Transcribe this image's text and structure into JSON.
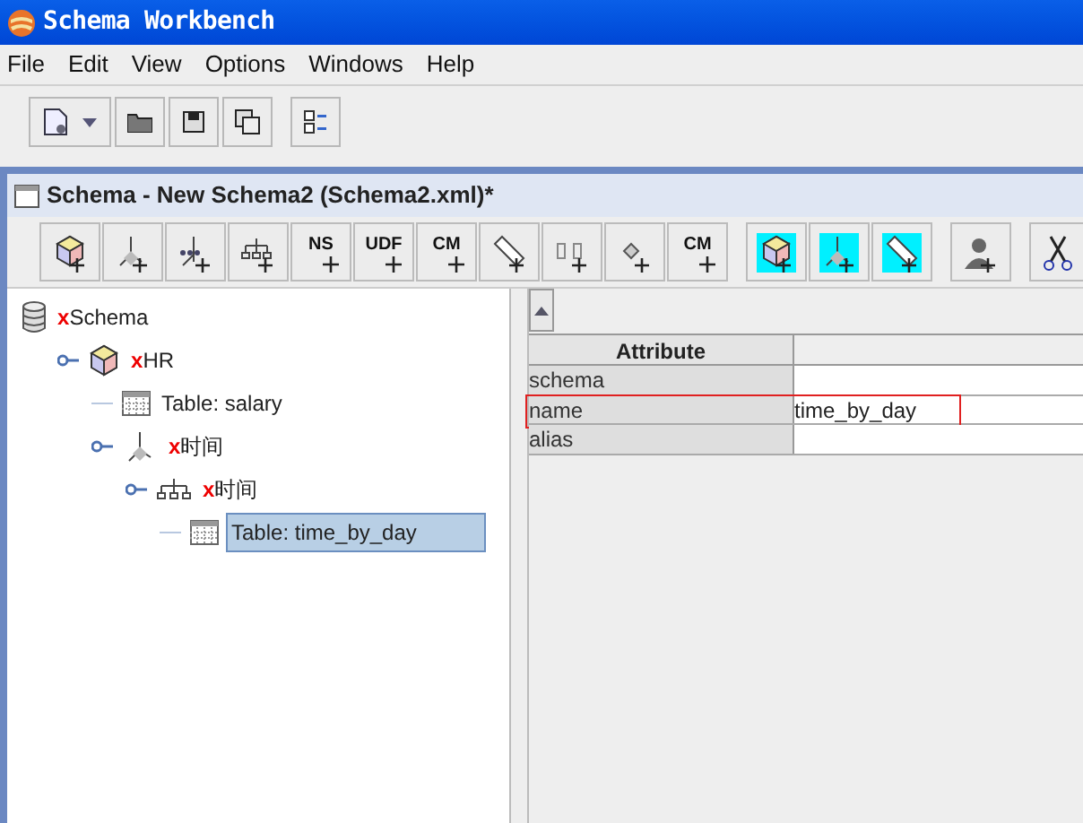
{
  "window": {
    "title": "Schema Workbench"
  },
  "menu": [
    "File",
    "Edit",
    "View",
    "Options",
    "Windows",
    "Help"
  ],
  "inner_window": {
    "title": "Schema - New Schema2 (Schema2.xml)*"
  },
  "schema_toolbar": {
    "labels": [
      "NS",
      "UDF",
      "CM",
      "CM"
    ]
  },
  "tree": [
    {
      "label": "Schema",
      "mark": "x",
      "kind": "schema",
      "selected": false,
      "children": [
        {
          "label": "HR",
          "mark": "x",
          "kind": "cube",
          "selected": false,
          "expanded": true,
          "children": [
            {
              "label": "Table: salary",
              "kind": "table",
              "selected": false
            },
            {
              "label": "时间",
              "mark": "x",
              "kind": "dimension",
              "selected": false,
              "expanded": true,
              "children": [
                {
                  "label": "时间",
                  "mark": "x",
                  "kind": "hierarchy",
                  "selected": false,
                  "expanded": true,
                  "children": [
                    {
                      "label": "Table: time_by_day",
                      "kind": "table",
                      "selected": true
                    }
                  ]
                }
              ]
            }
          ]
        }
      ]
    }
  ],
  "attributes": {
    "columns": [
      "Attribute"
    ],
    "rows": [
      {
        "attribute": "schema",
        "selected": false
      },
      {
        "attribute": "name",
        "value": "time_by_day",
        "selected": true
      },
      {
        "attribute": "alias",
        "selected": false
      }
    ]
  }
}
